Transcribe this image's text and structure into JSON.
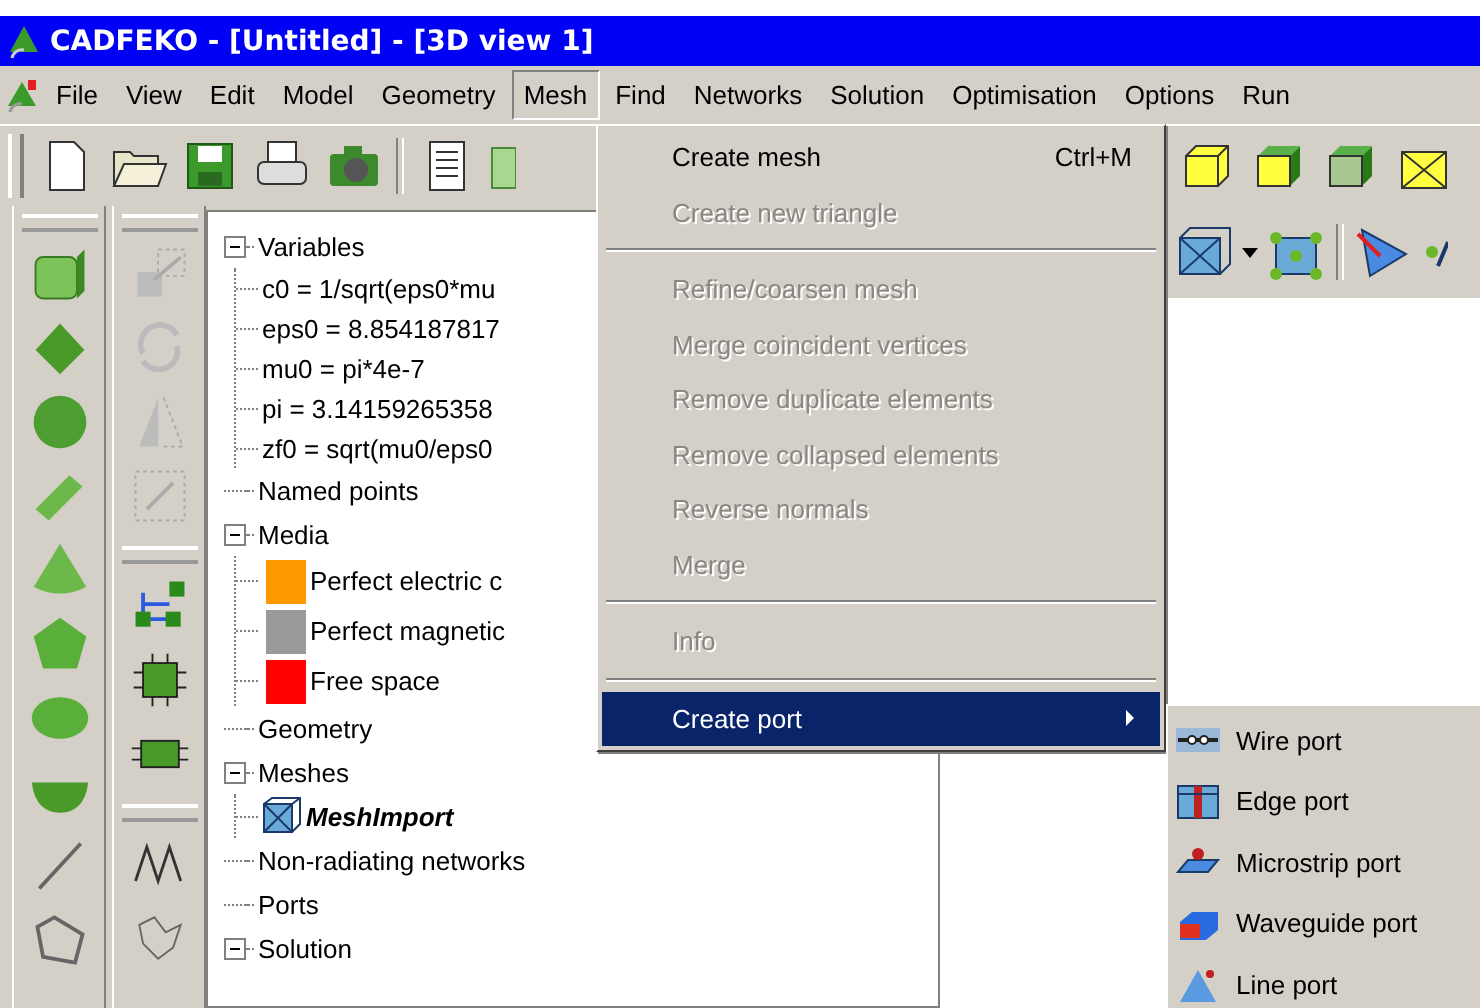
{
  "window": {
    "title": "CADFEKO - [Untitled] - [3D view 1]"
  },
  "menu_bar": [
    {
      "label": "File",
      "selected": false
    },
    {
      "label": "View",
      "selected": false
    },
    {
      "label": "Edit",
      "selected": false
    },
    {
      "label": "Model",
      "selected": false
    },
    {
      "label": "Geometry",
      "selected": false
    },
    {
      "label": "Mesh",
      "selected": true
    },
    {
      "label": "Find",
      "selected": false
    },
    {
      "label": "Networks",
      "selected": false
    },
    {
      "label": "Solution",
      "selected": false
    },
    {
      "label": "Optimisation",
      "selected": false
    },
    {
      "label": "Options",
      "selected": false
    },
    {
      "label": "Run",
      "selected": false
    }
  ],
  "tree": [
    {
      "label": "Variables",
      "expanded": true,
      "children": [
        {
          "label": "c0 = 1/sqrt(eps0*mu",
          "kind": "leaf"
        },
        {
          "label": "eps0 = 8.854187817",
          "kind": "leaf"
        },
        {
          "label": "mu0 = pi*4e-7",
          "kind": "leaf"
        },
        {
          "label": "pi = 3.14159265358",
          "kind": "leaf"
        },
        {
          "label": "zf0 = sqrt(mu0/eps0",
          "kind": "leaf"
        }
      ]
    },
    {
      "label": "Named points"
    },
    {
      "label": "Media",
      "expanded": true,
      "children": [
        {
          "label": "Perfect electric c",
          "kind": "medium",
          "color": "#ff9900"
        },
        {
          "label": "Perfect magnetic",
          "kind": "medium",
          "color": "#999999"
        },
        {
          "label": "Free space",
          "kind": "medium",
          "color": "#ff0000"
        }
      ]
    },
    {
      "label": "Geometry"
    },
    {
      "label": "Meshes",
      "expanded": true,
      "children": [
        {
          "label": "MeshImport",
          "kind": "mesh"
        }
      ]
    },
    {
      "label": "Non-radiating networks"
    },
    {
      "label": "Ports"
    },
    {
      "label": "Solution",
      "expanded": true
    }
  ],
  "mesh_menu": [
    {
      "kind": "item",
      "label": "Create mesh",
      "shortcut": "Ctrl+M",
      "disabled": false,
      "selected": false
    },
    {
      "kind": "item",
      "label": "Create new triangle",
      "disabled": true,
      "selected": false
    },
    {
      "kind": "separator"
    },
    {
      "kind": "item",
      "label": "Refine/coarsen mesh",
      "disabled": true,
      "selected": false
    },
    {
      "kind": "item",
      "label": "Merge coincident vertices",
      "disabled": true,
      "selected": false
    },
    {
      "kind": "item",
      "label": "Remove duplicate elements",
      "disabled": true,
      "selected": false
    },
    {
      "kind": "item",
      "label": "Remove collapsed elements",
      "disabled": true,
      "selected": false
    },
    {
      "kind": "item",
      "label": "Reverse normals",
      "disabled": true,
      "selected": false
    },
    {
      "kind": "item",
      "label": "Merge",
      "disabled": true,
      "selected": false
    },
    {
      "kind": "separator"
    },
    {
      "kind": "item",
      "label": "Info",
      "disabled": true,
      "selected": false
    },
    {
      "kind": "separator"
    },
    {
      "kind": "submenu",
      "label": "Create port",
      "disabled": false,
      "selected": true
    }
  ],
  "create_port_submenu": [
    {
      "kind": "wire",
      "label": "Wire port"
    },
    {
      "kind": "edge",
      "label": "Edge port"
    },
    {
      "kind": "microstrip",
      "label": "Microstrip port"
    },
    {
      "kind": "waveguide",
      "label": "Waveguide port"
    },
    {
      "kind": "line",
      "label": "Line port"
    }
  ]
}
